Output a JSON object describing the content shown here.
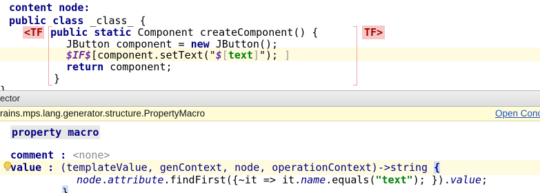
{
  "editor": {
    "header": "content node:",
    "class_kw": "public class",
    "class_name": " _class_ {",
    "tf_open": "<TF",
    "method_mod": "public static",
    "method_sig": " Component createComponent() {",
    "tf_close": "TF>",
    "line_jbutton_a": "JButton component = ",
    "new_kw": "new",
    "line_jbutton_b": " JButton();",
    "if_macro": "$IF$",
    "set_text_a": "[component.setText(\"",
    "prop_macro": "$",
    "prop_bracket_open": "[",
    "prop_text": "text",
    "prop_bracket_close": "]",
    "set_text_b": "\");",
    "set_text_end": " ]",
    "return_kw": "return",
    "return_rest": " component;",
    "close_method": "}",
    "close_class": "}"
  },
  "inspector": {
    "title": "ector",
    "concept_fqn": "rains.mps.lang.generator.structure.PropertyMacro",
    "open_concept": "Open Conc",
    "alias": "property macro",
    "comment_label": "comment",
    "comment_sep": " : ",
    "comment_value": "<none>",
    "value_label": "value",
    "value_sep": " : ",
    "value_signature": "(templateValue, genContext, node, operationContext)->string",
    "value_open": "{",
    "body_node": "node",
    "body_dot1": ".",
    "body_attribute": "attribute",
    "body_find": ".findFirst({~it => it.",
    "body_name": "name",
    "body_equals": ".equals(",
    "body_str": "\"text\"",
    "body_end": "); }).",
    "body_value": "value",
    "body_semicolon": ";",
    "value_close": "}"
  },
  "colors": {
    "keyword": "#000080",
    "string": "#008000",
    "tf_marker_bg": "#f7c8c8",
    "highlight_row": "#fffbe0",
    "link": "#1a4fd1"
  }
}
